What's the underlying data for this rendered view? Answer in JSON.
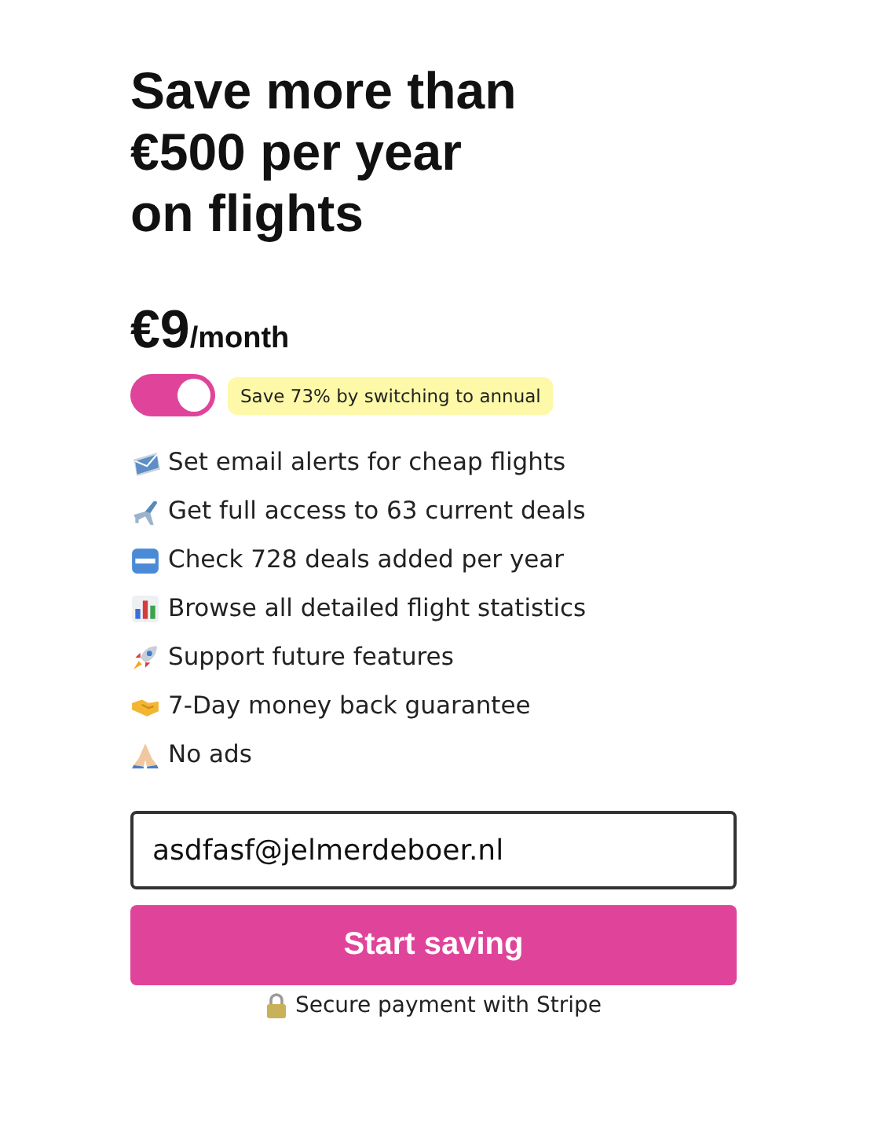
{
  "headline": "Save more than €500 per year on flights",
  "price": {
    "amount": "€9",
    "period": "/month"
  },
  "annual_toggle": {
    "on": true,
    "note": "Save 73% by switching to annual"
  },
  "features": [
    {
      "text": "Set email alerts for cheap flights"
    },
    {
      "text": "Get full access to 63 current deals"
    },
    {
      "text": "Check 728 deals added per year"
    },
    {
      "text": "Browse all detailed flight statistics"
    },
    {
      "text": "Support future features"
    },
    {
      "text": "7-Day money back guarantee"
    },
    {
      "text": "No ads"
    }
  ],
  "email_field": {
    "value": "asdfasf@jelmerdeboer.nl"
  },
  "submit_button": "Start saving",
  "secure_note": "Secure payment with Stripe"
}
